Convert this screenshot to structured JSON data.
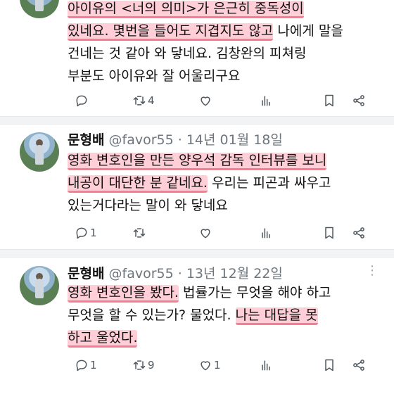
{
  "tweets": [
    {
      "lines": [
        [
          {
            "t": "아이유의 <너의 의미>가 은근히 중독성이",
            "h": true
          }
        ],
        [
          {
            "t": "있네요. 몇번을 들어도 지겹지도 않고",
            "h": true
          },
          {
            "t": " 나에게 말을",
            "h": false
          }
        ],
        [
          {
            "t": "건네는 것 같아 와 닿네요. 김창완의 피쳐링",
            "h": false
          }
        ],
        [
          {
            "t": "부분도 아이유와 잘 어울리구요",
            "h": false
          }
        ]
      ],
      "actions": {
        "reply": "",
        "retweet": "4",
        "like": "",
        "views": ""
      }
    },
    {
      "user": {
        "name": "문형배",
        "handle": "@favor55",
        "date": "· 14년 01월 18일"
      },
      "lines": [
        [
          {
            "t": "영화 변호인을 만든 양우석 감독 인터뷰를 보니",
            "h": true
          }
        ],
        [
          {
            "t": "내공이 대단한 분 같네요.",
            "h": true
          },
          {
            "t": " 우리는 피곤과 싸우고",
            "h": false
          }
        ],
        [
          {
            "t": "있는거다라는 말이 와 닿네요",
            "h": false
          }
        ]
      ],
      "actions": {
        "reply": "1",
        "retweet": "",
        "like": "",
        "views": ""
      }
    },
    {
      "user": {
        "name": "문형배",
        "handle": "@favor55",
        "date": "· 13년 12월 22일"
      },
      "lines": [
        [
          {
            "t": "영화 변호인을 봤다.",
            "h": true
          },
          {
            "t": " 법률가는 무엇을 해야 하고",
            "h": false
          }
        ],
        [
          {
            "t": "무엇을 할 수 있는가?  물었다. ",
            "h": false
          },
          {
            "t": "나는 대답을 못",
            "h": true
          }
        ],
        [
          {
            "t": "하고 울었다.",
            "h": true
          }
        ]
      ],
      "actions": {
        "reply": "1",
        "retweet": "9",
        "like": "1",
        "views": ""
      }
    }
  ],
  "icons": [
    "reply-icon",
    "retweet-icon",
    "like-icon",
    "views-icon",
    "bookmark-icon",
    "share-icon",
    "more-icon"
  ]
}
